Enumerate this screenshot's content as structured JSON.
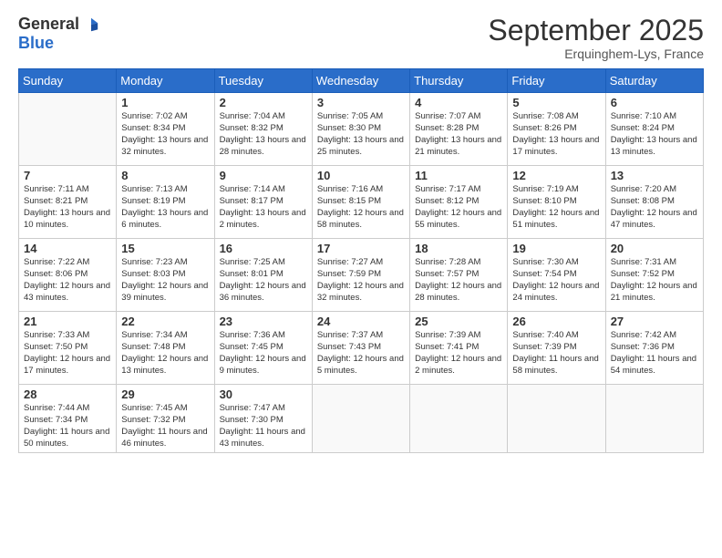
{
  "logo": {
    "general": "General",
    "blue": "Blue"
  },
  "title": "September 2025",
  "location": "Erquinghem-Lys, France",
  "weekdays": [
    "Sunday",
    "Monday",
    "Tuesday",
    "Wednesday",
    "Thursday",
    "Friday",
    "Saturday"
  ],
  "weeks": [
    [
      {
        "day": "",
        "sunrise": "",
        "sunset": "",
        "daylight": ""
      },
      {
        "day": "1",
        "sunrise": "Sunrise: 7:02 AM",
        "sunset": "Sunset: 8:34 PM",
        "daylight": "Daylight: 13 hours and 32 minutes."
      },
      {
        "day": "2",
        "sunrise": "Sunrise: 7:04 AM",
        "sunset": "Sunset: 8:32 PM",
        "daylight": "Daylight: 13 hours and 28 minutes."
      },
      {
        "day": "3",
        "sunrise": "Sunrise: 7:05 AM",
        "sunset": "Sunset: 8:30 PM",
        "daylight": "Daylight: 13 hours and 25 minutes."
      },
      {
        "day": "4",
        "sunrise": "Sunrise: 7:07 AM",
        "sunset": "Sunset: 8:28 PM",
        "daylight": "Daylight: 13 hours and 21 minutes."
      },
      {
        "day": "5",
        "sunrise": "Sunrise: 7:08 AM",
        "sunset": "Sunset: 8:26 PM",
        "daylight": "Daylight: 13 hours and 17 minutes."
      },
      {
        "day": "6",
        "sunrise": "Sunrise: 7:10 AM",
        "sunset": "Sunset: 8:24 PM",
        "daylight": "Daylight: 13 hours and 13 minutes."
      }
    ],
    [
      {
        "day": "7",
        "sunrise": "Sunrise: 7:11 AM",
        "sunset": "Sunset: 8:21 PM",
        "daylight": "Daylight: 13 hours and 10 minutes."
      },
      {
        "day": "8",
        "sunrise": "Sunrise: 7:13 AM",
        "sunset": "Sunset: 8:19 PM",
        "daylight": "Daylight: 13 hours and 6 minutes."
      },
      {
        "day": "9",
        "sunrise": "Sunrise: 7:14 AM",
        "sunset": "Sunset: 8:17 PM",
        "daylight": "Daylight: 13 hours and 2 minutes."
      },
      {
        "day": "10",
        "sunrise": "Sunrise: 7:16 AM",
        "sunset": "Sunset: 8:15 PM",
        "daylight": "Daylight: 12 hours and 58 minutes."
      },
      {
        "day": "11",
        "sunrise": "Sunrise: 7:17 AM",
        "sunset": "Sunset: 8:12 PM",
        "daylight": "Daylight: 12 hours and 55 minutes."
      },
      {
        "day": "12",
        "sunrise": "Sunrise: 7:19 AM",
        "sunset": "Sunset: 8:10 PM",
        "daylight": "Daylight: 12 hours and 51 minutes."
      },
      {
        "day": "13",
        "sunrise": "Sunrise: 7:20 AM",
        "sunset": "Sunset: 8:08 PM",
        "daylight": "Daylight: 12 hours and 47 minutes."
      }
    ],
    [
      {
        "day": "14",
        "sunrise": "Sunrise: 7:22 AM",
        "sunset": "Sunset: 8:06 PM",
        "daylight": "Daylight: 12 hours and 43 minutes."
      },
      {
        "day": "15",
        "sunrise": "Sunrise: 7:23 AM",
        "sunset": "Sunset: 8:03 PM",
        "daylight": "Daylight: 12 hours and 39 minutes."
      },
      {
        "day": "16",
        "sunrise": "Sunrise: 7:25 AM",
        "sunset": "Sunset: 8:01 PM",
        "daylight": "Daylight: 12 hours and 36 minutes."
      },
      {
        "day": "17",
        "sunrise": "Sunrise: 7:27 AM",
        "sunset": "Sunset: 7:59 PM",
        "daylight": "Daylight: 12 hours and 32 minutes."
      },
      {
        "day": "18",
        "sunrise": "Sunrise: 7:28 AM",
        "sunset": "Sunset: 7:57 PM",
        "daylight": "Daylight: 12 hours and 28 minutes."
      },
      {
        "day": "19",
        "sunrise": "Sunrise: 7:30 AM",
        "sunset": "Sunset: 7:54 PM",
        "daylight": "Daylight: 12 hours and 24 minutes."
      },
      {
        "day": "20",
        "sunrise": "Sunrise: 7:31 AM",
        "sunset": "Sunset: 7:52 PM",
        "daylight": "Daylight: 12 hours and 21 minutes."
      }
    ],
    [
      {
        "day": "21",
        "sunrise": "Sunrise: 7:33 AM",
        "sunset": "Sunset: 7:50 PM",
        "daylight": "Daylight: 12 hours and 17 minutes."
      },
      {
        "day": "22",
        "sunrise": "Sunrise: 7:34 AM",
        "sunset": "Sunset: 7:48 PM",
        "daylight": "Daylight: 12 hours and 13 minutes."
      },
      {
        "day": "23",
        "sunrise": "Sunrise: 7:36 AM",
        "sunset": "Sunset: 7:45 PM",
        "daylight": "Daylight: 12 hours and 9 minutes."
      },
      {
        "day": "24",
        "sunrise": "Sunrise: 7:37 AM",
        "sunset": "Sunset: 7:43 PM",
        "daylight": "Daylight: 12 hours and 5 minutes."
      },
      {
        "day": "25",
        "sunrise": "Sunrise: 7:39 AM",
        "sunset": "Sunset: 7:41 PM",
        "daylight": "Daylight: 12 hours and 2 minutes."
      },
      {
        "day": "26",
        "sunrise": "Sunrise: 7:40 AM",
        "sunset": "Sunset: 7:39 PM",
        "daylight": "Daylight: 11 hours and 58 minutes."
      },
      {
        "day": "27",
        "sunrise": "Sunrise: 7:42 AM",
        "sunset": "Sunset: 7:36 PM",
        "daylight": "Daylight: 11 hours and 54 minutes."
      }
    ],
    [
      {
        "day": "28",
        "sunrise": "Sunrise: 7:44 AM",
        "sunset": "Sunset: 7:34 PM",
        "daylight": "Daylight: 11 hours and 50 minutes."
      },
      {
        "day": "29",
        "sunrise": "Sunrise: 7:45 AM",
        "sunset": "Sunset: 7:32 PM",
        "daylight": "Daylight: 11 hours and 46 minutes."
      },
      {
        "day": "30",
        "sunrise": "Sunrise: 7:47 AM",
        "sunset": "Sunset: 7:30 PM",
        "daylight": "Daylight: 11 hours and 43 minutes."
      },
      {
        "day": "",
        "sunrise": "",
        "sunset": "",
        "daylight": ""
      },
      {
        "day": "",
        "sunrise": "",
        "sunset": "",
        "daylight": ""
      },
      {
        "day": "",
        "sunrise": "",
        "sunset": "",
        "daylight": ""
      },
      {
        "day": "",
        "sunrise": "",
        "sunset": "",
        "daylight": ""
      }
    ]
  ]
}
